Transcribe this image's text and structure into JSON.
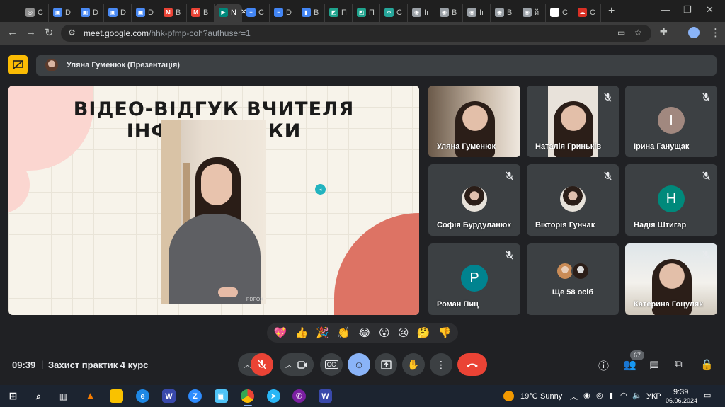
{
  "browser": {
    "tabs": [
      {
        "title": "C",
        "color": "#8e8e8e",
        "glyph": "◎"
      },
      {
        "title": "D",
        "color": "#4a8af4",
        "glyph": "▣"
      },
      {
        "title": "D",
        "color": "#4a8af4",
        "glyph": "▣"
      },
      {
        "title": "D",
        "color": "#4a8af4",
        "glyph": "▣"
      },
      {
        "title": "D",
        "color": "#4a8af4",
        "glyph": "▣"
      },
      {
        "title": "B",
        "color": "#ea4335",
        "glyph": "M"
      },
      {
        "title": "B",
        "color": "#ea4335",
        "glyph": "M"
      },
      {
        "title": "N",
        "color": "#00897b",
        "glyph": "▶",
        "active": true
      },
      {
        "title": "C",
        "color": "#4285f4",
        "glyph": "≡"
      },
      {
        "title": "D",
        "color": "#4285f4",
        "glyph": "≡"
      },
      {
        "title": "B",
        "color": "#4285f4",
        "glyph": "▮"
      },
      {
        "title": "П",
        "color": "#1fa38d",
        "glyph": "◩"
      },
      {
        "title": "П",
        "color": "#1fa38d",
        "glyph": "◩"
      },
      {
        "title": "C",
        "color": "#26a69a",
        "glyph": "∞"
      },
      {
        "title": "Iı",
        "color": "#9aa0a6",
        "glyph": "◉"
      },
      {
        "title": "B",
        "color": "#9aa0a6",
        "glyph": "◉"
      },
      {
        "title": "Iı",
        "color": "#9aa0a6",
        "glyph": "◉"
      },
      {
        "title": "B",
        "color": "#9aa0a6",
        "glyph": "◉"
      },
      {
        "title": "й",
        "color": "#9aa0a6",
        "glyph": "◉"
      },
      {
        "title": "C",
        "color": "#ffffff",
        "glyph": "∞"
      },
      {
        "title": "C",
        "color": "#d93025",
        "glyph": "☁"
      }
    ],
    "new_tab": "+",
    "url_host": "meet.google.com",
    "url_path": "/hhk-pfmp-coh?authuser=1"
  },
  "meet": {
    "presenter_label": "Уляна Гуменюк (Презентація)",
    "slide_title": "ВІДЕО-ВІДГУК ВЧИТЕЛЯ ІНФОРМАТИКИ",
    "video_watermark": "PDFOX",
    "participants": [
      {
        "name": "Уляна Гуменюк",
        "type": "camera",
        "muted": false
      },
      {
        "name": "Наталія Гриньків",
        "type": "camera",
        "muted": true
      },
      {
        "name": "Ірина Ганущак",
        "type": "letter",
        "letter": "I",
        "color": "#a1887f",
        "muted": true
      },
      {
        "name": "Софія Бурдуланюк",
        "type": "photo",
        "muted": true
      },
      {
        "name": "Вікторія Гунчак",
        "type": "photo",
        "muted": true
      },
      {
        "name": "Надія Штигар",
        "type": "letter",
        "letter": "H",
        "color": "#00897b",
        "muted": true
      },
      {
        "name": "Роман Пиц",
        "type": "letter",
        "letter": "P",
        "color": "#00838f",
        "muted": true
      },
      {
        "name": "",
        "type": "more",
        "label": "Ще 58 осіб",
        "muted": false
      },
      {
        "name": "Катерина Гоцуляк",
        "type": "camera",
        "muted": true
      }
    ],
    "reactions": [
      "💖",
      "👍",
      "🎉",
      "👏",
      "😂",
      "😮",
      "😢",
      "🤔",
      "👎"
    ],
    "time": "09:39",
    "separator": "|",
    "meeting_name": "Захист практик 4 курс",
    "people_count": "67"
  },
  "taskbar": {
    "weather_temp": "19°C",
    "weather_text": "Sunny",
    "language": "УКР",
    "clock_time": "9:39",
    "clock_date": "06.06.2024"
  },
  "colors": {
    "accent_red": "#ea4335",
    "accent_blue": "#8ab4f8",
    "presenting_yellow": "#fbbc04"
  }
}
